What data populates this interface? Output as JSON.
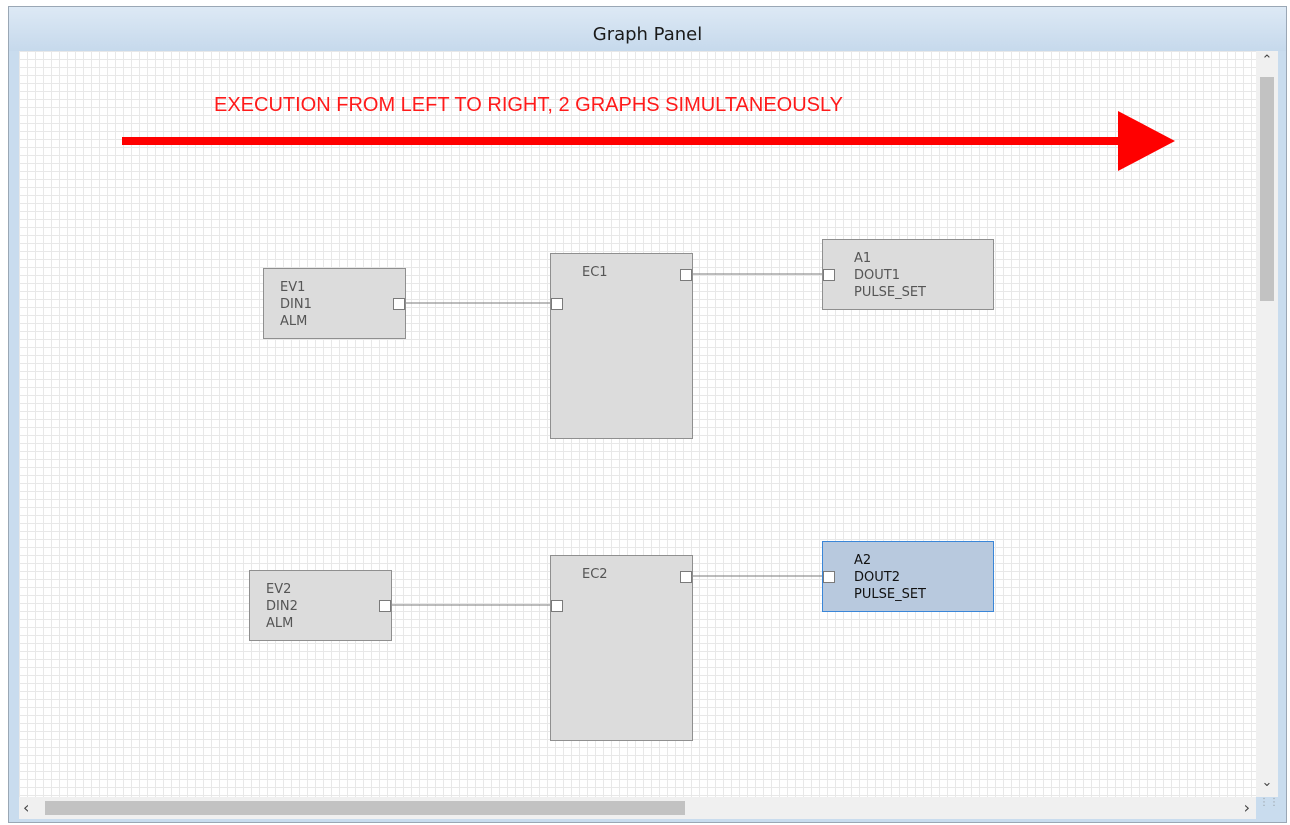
{
  "window": {
    "title": "Graph Panel"
  },
  "banner": {
    "text": "EXECUTION FROM LEFT TO RIGHT, 2 GRAPHS SIMULTANEOUSLY",
    "color": "#ff1a1a"
  },
  "graphs": [
    {
      "event": {
        "line1": "EV1",
        "line2": "DIN1",
        "line3": "ALM"
      },
      "controller": {
        "label": "EC1"
      },
      "action": {
        "line1": "A1",
        "line2": "DOUT1",
        "line3": "PULSE_SET",
        "selected": false
      }
    },
    {
      "event": {
        "line1": "EV2",
        "line2": "DIN2",
        "line3": "ALM"
      },
      "controller": {
        "label": "EC2"
      },
      "action": {
        "line1": "A2",
        "line2": "DOUT2",
        "line3": "PULSE_SET",
        "selected": true
      }
    }
  ],
  "scrollbars": {
    "up_icon": "chevron-up-icon",
    "down_icon": "chevron-down-icon",
    "left_icon": "chevron-left-icon",
    "right_icon": "chevron-right-icon"
  },
  "colors": {
    "selected_fill": "#b8c9de",
    "selected_border": "#3a86d8",
    "node_fill": "#dcdcdc"
  }
}
